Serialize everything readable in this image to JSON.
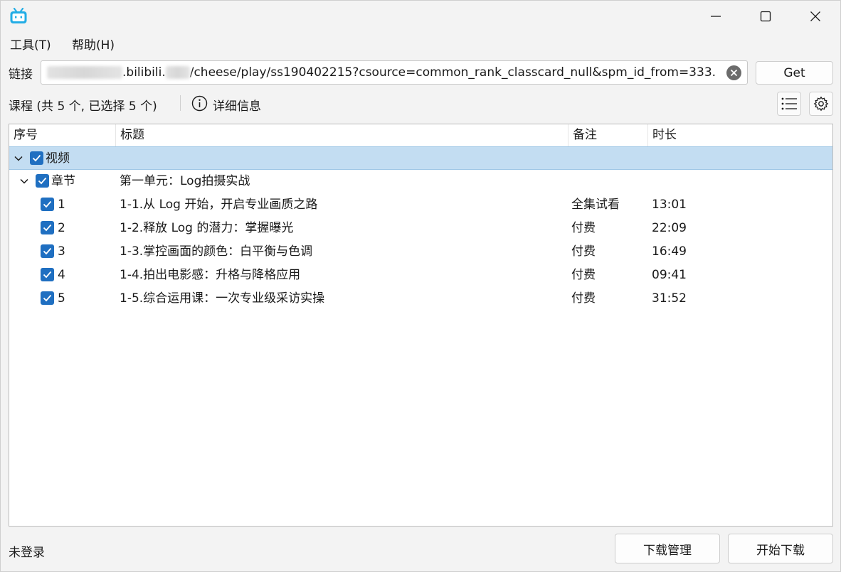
{
  "menu": {
    "tools": "工具(T)",
    "help": "帮助(H)"
  },
  "url_row": {
    "label": "链接",
    "value_visible_part1": ".bilibili.",
    "value_visible_part2": "/cheese/play/ss190402215?csource=common_rank_classcard_null&spm_id_from=333.",
    "get_label": "Get"
  },
  "course": {
    "summary": "课程 (共 5 个, 已选择 5 个)",
    "details_label": "详细信息"
  },
  "table": {
    "columns": [
      "序号",
      "标题",
      "备注",
      "时长"
    ],
    "group_label": "视频",
    "chapter_label": "章节",
    "chapter_title": "第一单元：Log拍摄实战",
    "rows": [
      {
        "index": "1",
        "title": "1-1.从 Log 开始，开启专业画质之路",
        "note": "全集试看",
        "duration": "13:01"
      },
      {
        "index": "2",
        "title": "1-2.释放 Log 的潜力：掌握曝光",
        "note": "付费",
        "duration": "22:09"
      },
      {
        "index": "3",
        "title": "1-3.掌控画面的颜色：白平衡与色调",
        "note": "付费",
        "duration": "16:49"
      },
      {
        "index": "4",
        "title": "1-4.拍出电影感：升格与降格应用",
        "note": "付费",
        "duration": "09:41"
      },
      {
        "index": "5",
        "title": "1-5.综合运用课：一次专业级采访实操",
        "note": "付费",
        "duration": "31:52"
      }
    ]
  },
  "footer": {
    "status": "未登录",
    "manage_label": "下载管理",
    "start_label": "开始下载"
  },
  "colors": {
    "accent": "#1f6fc1",
    "selection": "#c3ddf2",
    "logo": "#23ade5"
  },
  "icons": {
    "logo": "bilibili-tv-icon",
    "minimize": "minimize-icon",
    "maximize": "maximize-icon",
    "close": "close-icon",
    "clear": "clear-icon",
    "info": "info-icon",
    "list": "list-icon",
    "settings": "gear-icon"
  }
}
